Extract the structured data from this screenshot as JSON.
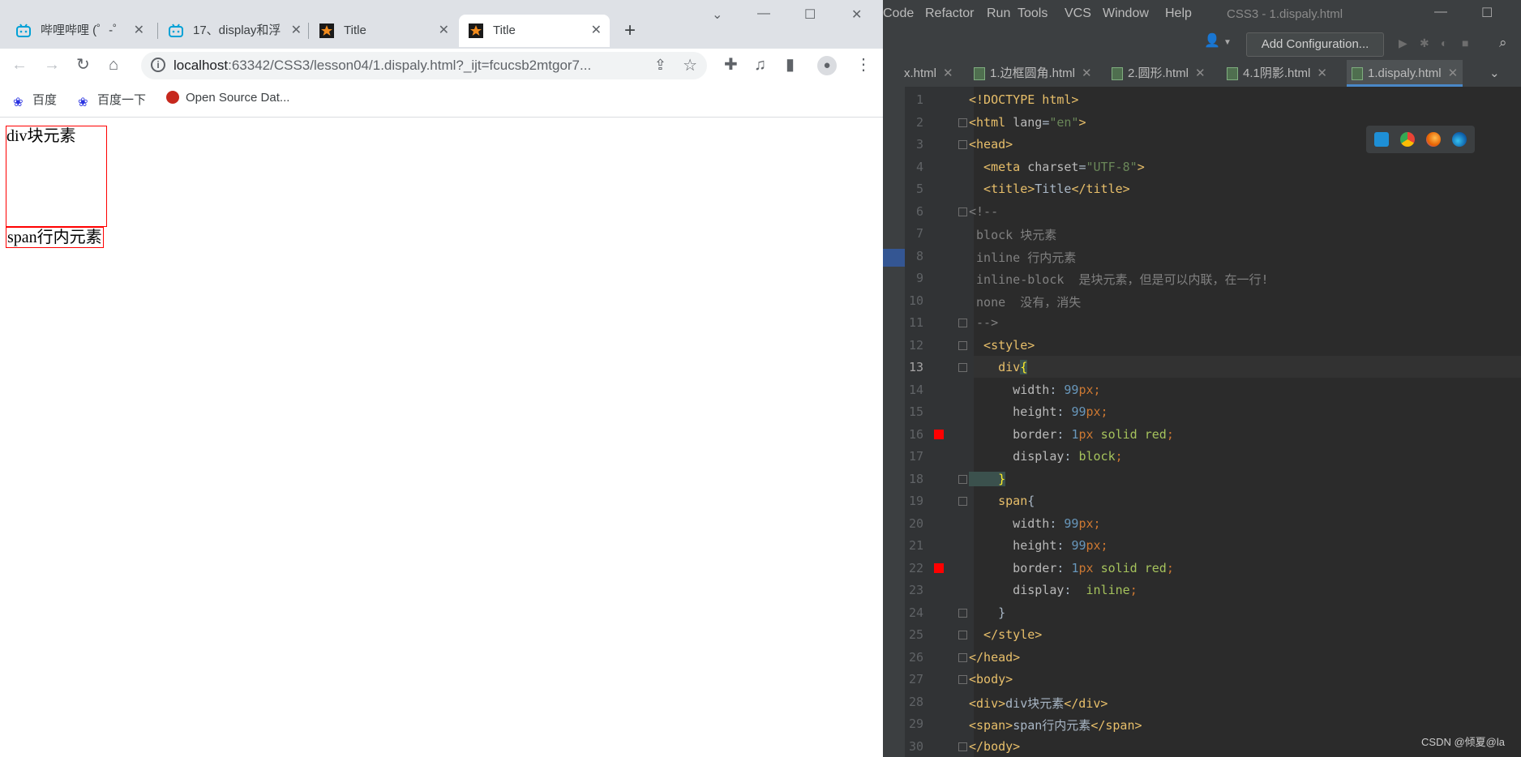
{
  "browser": {
    "tabs": [
      {
        "label": "哔哩哔哩 (゜-゜",
        "favicon": "bilibili-icon"
      },
      {
        "label": "17、display和浮",
        "favicon": "bilibili-icon"
      },
      {
        "label": "Title",
        "favicon": "webstorm-star-icon"
      },
      {
        "label": "Title",
        "favicon": "webstorm-star-icon",
        "active": true
      }
    ],
    "new_tab": "+",
    "url_host": "localhost",
    "url_rest": ":63342/CSS3/lesson04/1.dispaly.html?_ijt=fcucsb2mtgor7...",
    "bookmarks": [
      "百度",
      "百度一下",
      "Open Source Dat..."
    ],
    "page": {
      "div_text": "div块元素",
      "span_text": "span行内元素"
    }
  },
  "ide": {
    "menu": [
      "Code",
      "Refactor",
      "Run",
      "Tools",
      "VCS",
      "Window",
      "Help"
    ],
    "title": "CSS3 - 1.dispaly.html",
    "add_config": "Add Configuration...",
    "tabs": [
      "x.html",
      "1.边框圆角.html",
      "2.圆形.html",
      "4.1阴影.html",
      "1.dispaly.html"
    ],
    "active_tab": "1.dispaly.html",
    "current_line": 13,
    "breakpoint_lines": [
      16,
      22
    ],
    "line_numbers": [
      "1",
      "2",
      "3",
      "4",
      "5",
      "6",
      "7",
      "8",
      "9",
      "10",
      "11",
      "12",
      "13",
      "14",
      "15",
      "16",
      "17",
      "18",
      "19",
      "20",
      "21",
      "22",
      "23",
      "24",
      "25",
      "26",
      "27",
      "28",
      "29",
      "30"
    ],
    "code": {
      "l1": "<!DOCTYPE html>",
      "l2a": "<html ",
      "l2b": "lang",
      "l2c": "=",
      "l2d": "\"en\"",
      "l2e": ">",
      "l3": "<head>",
      "l4a": "  <meta ",
      "l4b": "charset",
      "l4c": "=",
      "l4d": "\"UTF-8\"",
      "l4e": ">",
      "l5a": "  <title>",
      "l5b": "Title",
      "l5c": "</title>",
      "l6": "<!--",
      "l7": " block 块元素",
      "l8": " inline 行内元素",
      "l9": " inline-block  是块元素，但是可以内联，在一行!",
      "l10": " none  没有，消失",
      "l11": " -->",
      "l12": "  <style>",
      "l13a": "    div",
      "l13b": "{",
      "l14a": "      width",
      "l14b": ": ",
      "l14c": "99",
      "l14d": "px;",
      "l15a": "      height",
      "l15b": ": ",
      "l15c": "99",
      "l15d": "px;",
      "l16a": "      border",
      "l16b": ": ",
      "l16c": "1",
      "l16d": "px ",
      "l16e": "solid red",
      "l16f": ";",
      "l17a": "      display",
      "l17b": ": ",
      "l17c": "block",
      "l17d": ";",
      "l18": "    }",
      "l19a": "    span",
      "l19b": "{",
      "l20a": "      width",
      "l20b": ": ",
      "l20c": "99",
      "l20d": "px;",
      "l21a": "      height",
      "l21b": ": ",
      "l21c": "99",
      "l21d": "px;",
      "l22a": "      border",
      "l22b": ": ",
      "l22c": "1",
      "l22d": "px ",
      "l22e": "solid red",
      "l22f": ";",
      "l23a": "      display",
      "l23b": ":  ",
      "l23c": "inline",
      "l23d": ";",
      "l24": "    }",
      "l25": "  </style>",
      "l26": "</head>",
      "l27": "<body>",
      "l28a": "<div>",
      "l28b": "div块元素",
      "l28c": "</div>",
      "l29a": "<span>",
      "l29b": "span行内元素",
      "l29c": "</span>",
      "l30": "</body>"
    },
    "watermark": "CSDN @倾夏@la"
  },
  "colors": {
    "accent": "#4a88c7",
    "breakpoint": "#ff0000",
    "demo_border": "#ff0000"
  }
}
